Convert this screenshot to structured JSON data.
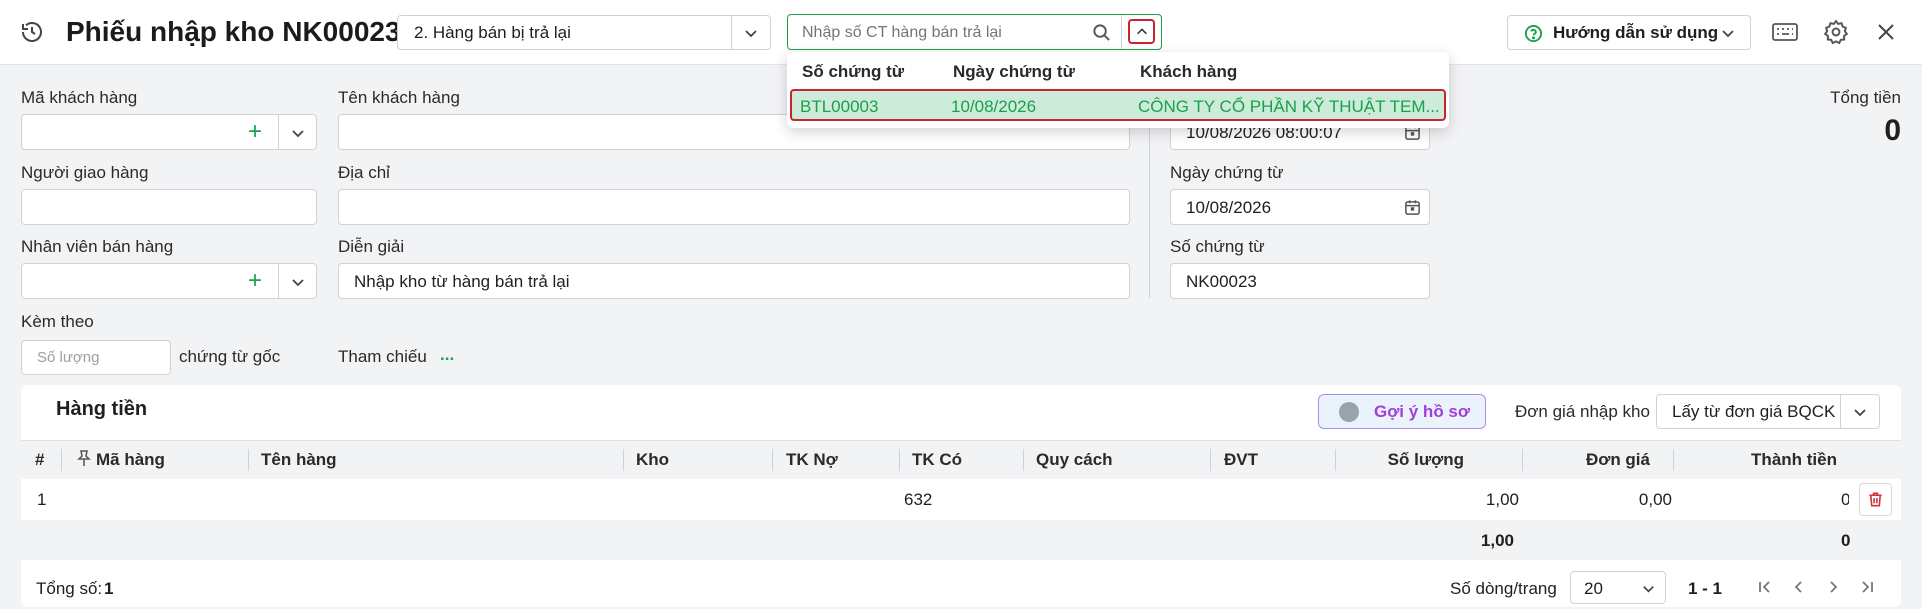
{
  "header": {
    "title": "Phiếu nhập kho NK00023",
    "type_select": "2. Hàng bán bị trả lại",
    "search_placeholder": "Nhập số CT hàng bán trả lại",
    "help_label": "Hướng dẫn sử dụng"
  },
  "dropdown": {
    "columns": [
      "Số chứng từ",
      "Ngày chứng từ",
      "Khách hàng"
    ],
    "row": {
      "so_ct": "BTL00003",
      "ngay_ct": "10/08/2026",
      "khach_hang": "CÔNG TY CỔ PHẦN KỸ THUẬT TEM..."
    }
  },
  "form": {
    "ma_kh_label": "Mã khách hàng",
    "ten_kh_label": "Tên khách hàng",
    "nguoi_giao_label": "Người giao hàng",
    "dia_chi_label": "Địa chỉ",
    "nv_ban_label": "Nhân viên bán hàng",
    "dien_giai_label": "Diễn giải",
    "dien_giai_value": "Nhập kho từ hàng bán trả lại",
    "kem_theo_label": "Kèm theo",
    "so_luong_placeholder": "Số lượng",
    "chung_tu_goc": "chứng từ gốc",
    "tham_chieu_label": "Tham chiếu",
    "tham_chieu_more": "...",
    "ngay_hach_toan_value": "10/08/2026 08:00:07",
    "ngay_ct_label": "Ngày chứng từ",
    "ngay_ct_value": "10/08/2026",
    "so_ct_label": "Số chứng từ",
    "so_ct_value": "NK00023",
    "tong_tien_label": "Tổng tiền",
    "tong_tien_value": "0"
  },
  "grid": {
    "section_title": "Hàng tiền",
    "goi_y_label": "Gợi ý hồ sơ",
    "don_gia_nhap_label": "Đơn giá nhập kho",
    "don_gia_select": "Lấy từ đơn giá BQCK",
    "columns": [
      "#",
      "Mã hàng",
      "Tên hàng",
      "Kho",
      "TK Nợ",
      "TK Có",
      "Quy cách",
      "ĐVT",
      "Số lượng",
      "Đơn giá",
      "Thành tiền"
    ],
    "rows": [
      {
        "stt": "1",
        "ma_hang": "",
        "ten_hang": "",
        "kho": "",
        "tk_no": "",
        "tk_co": "632",
        "quy_cach": "",
        "dvt": "",
        "so_luong": "1,00",
        "don_gia": "0,00",
        "thanh_tien": "0"
      }
    ],
    "total_so_luong": "1,00",
    "total_thanh_tien": "0"
  },
  "footer": {
    "tong_so_label": "Tổng số:",
    "tong_so_value": "1",
    "rows_per_page_label": "Số dòng/trang",
    "rows_per_page": "20",
    "page_range": "1 - 1"
  },
  "colors": {
    "accent_green": "#1aa04f",
    "highlight_row": "#cdebd9",
    "highlight_border": "#c8252c"
  }
}
